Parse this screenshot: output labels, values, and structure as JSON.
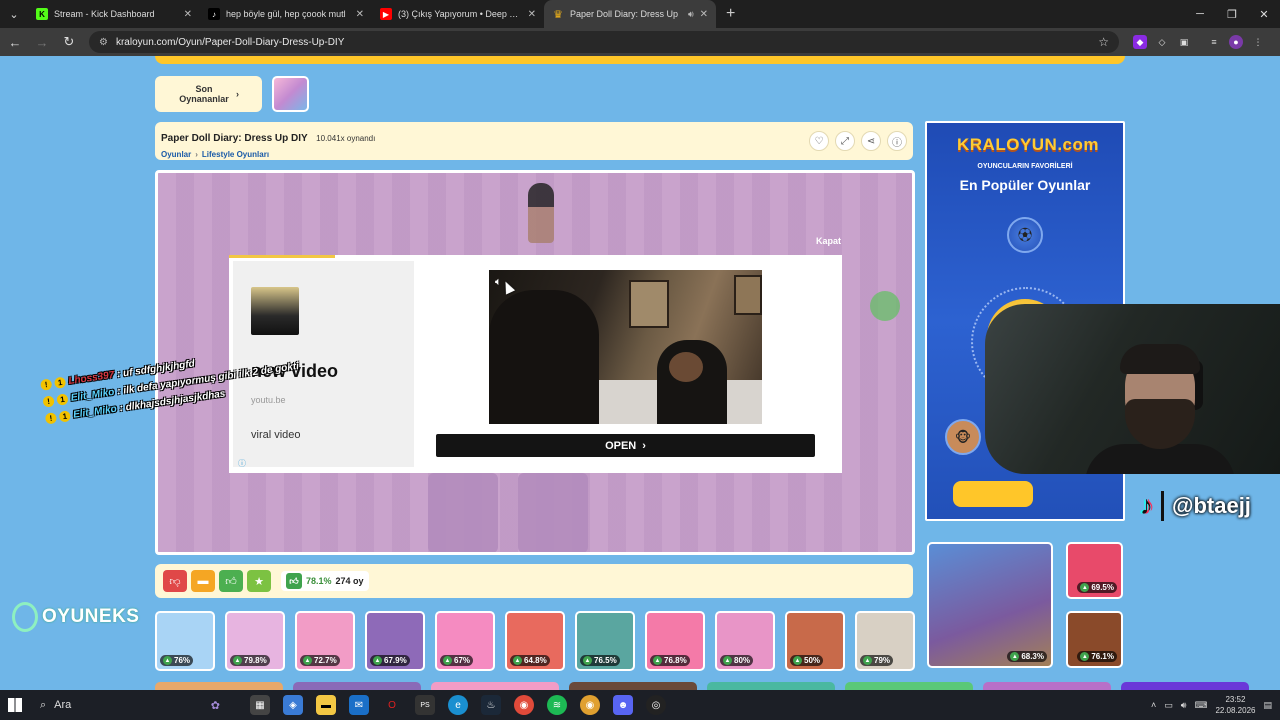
{
  "browser": {
    "tabs": [
      {
        "title": "Stream - Kick Dashboard",
        "favicon_color": "#53fc18",
        "favicon_glyph": "K",
        "active": false
      },
      {
        "title": "hep böyle gül, hep çoook mutl",
        "favicon_color": "#000000",
        "favicon_glyph": "♪",
        "active": false
      },
      {
        "title": "(3) Çıkış Yapıyorum • Deep Turt",
        "favicon_color": "#ff0000",
        "favicon_glyph": "▶",
        "active": false
      },
      {
        "title": "Paper Doll Diary: Dress Up",
        "favicon_color": "#f2b418",
        "favicon_glyph": "♛",
        "active": true
      }
    ],
    "url": "kraloyun.com/Oyun/Paper-Doll-Diary-Dress-Up-DIY"
  },
  "page": {
    "recent": {
      "label": "Son Oynananlar"
    },
    "game": {
      "title": "Paper Doll Diary: Dress Up DIY",
      "plays": "10.041x oynandı",
      "breadcrumb": [
        "Oyunlar",
        "Lifestyle Oyunları"
      ]
    },
    "ad": {
      "close_label": "Kapat",
      "title": "new video",
      "domain": "youtu.be",
      "description": "viral video",
      "open_label": "OPEN"
    },
    "rating": {
      "percent": "78.1%",
      "votes": "274 oy"
    },
    "thumbs": [
      {
        "score": "76%",
        "color": "#a9d4f5"
      },
      {
        "score": "79.8%",
        "color": "#e7b4e0"
      },
      {
        "score": "72.7%",
        "color": "#f29cc6"
      },
      {
        "score": "67.9%",
        "color": "#8e6ab8"
      },
      {
        "score": "67%",
        "color": "#f58bc1"
      },
      {
        "score": "64.8%",
        "color": "#e86a5e"
      },
      {
        "score": "76.5%",
        "color": "#5aa6a0"
      },
      {
        "score": "76.8%",
        "color": "#f47aa8"
      },
      {
        "score": "80%",
        "color": "#e895c7"
      },
      {
        "score": "50%",
        "color": "#c86a4a"
      },
      {
        "score": "79%",
        "color": "#d8d0c4"
      }
    ],
    "bottom_row_colors": [
      "#e8a86a",
      "#8a6ab8",
      "#f29cc6",
      "#6a4a3a",
      "#4ab8a0",
      "#5ac878",
      "#b870c8",
      "#6a38d8"
    ],
    "sidead": {
      "logo": "KRALOYUN.com",
      "subtitle": "OYUNCULARIN FAVORİLERİ",
      "title": "En Popüler Oyunlar"
    },
    "featured": {
      "score": "68.3%"
    },
    "side_small": [
      {
        "score": "69.5%",
        "color": "#e84a6a"
      },
      {
        "score": "76.1%",
        "color": "#8a4a2a"
      }
    ]
  },
  "overlay": {
    "chat": [
      {
        "user": "Lhoss397",
        "message": ": uf sdfghjkjhgfd",
        "user_color": "red"
      },
      {
        "user": "Elit_Miko",
        "message": ": ilk defa yapıyormuş gibi ilk 2 de gokti",
        "user_color": "blue"
      },
      {
        "user": "Elit_Miko",
        "message": ": dlkhajsdsjhjasjkdhas",
        "user_color": "blue"
      }
    ],
    "tiktok_handle": "@btaejj",
    "brand": "OYUNEKS"
  },
  "taskbar": {
    "search_label": "Ara",
    "time": "23:52",
    "date": "22.08.2026"
  }
}
